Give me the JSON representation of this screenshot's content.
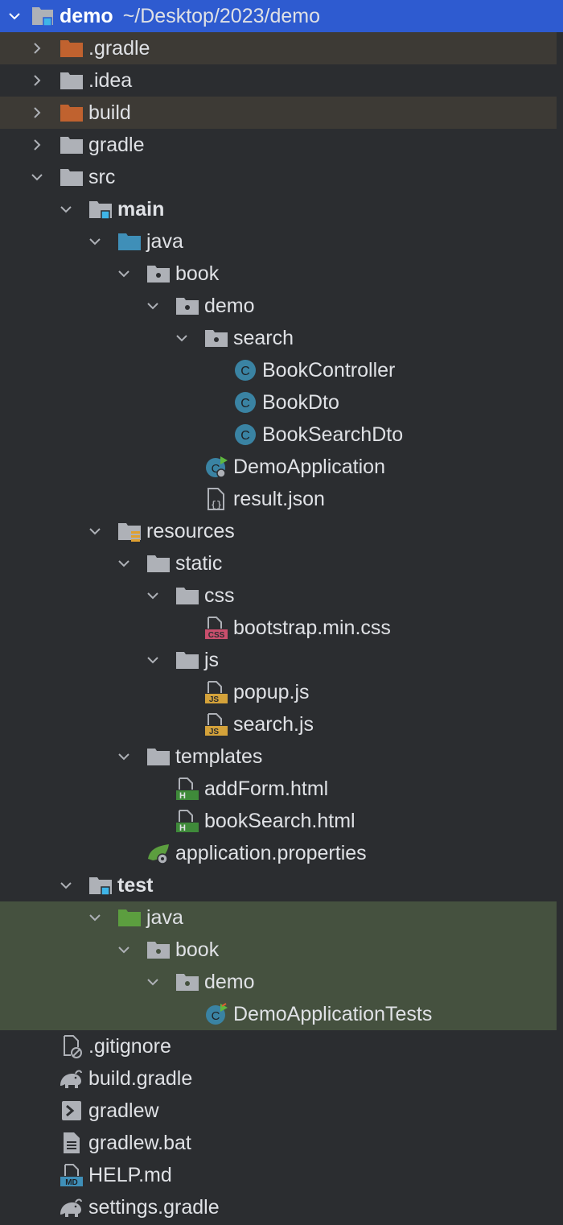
{
  "project": {
    "name": "demo",
    "path": "~/Desktop/2023/demo"
  },
  "tree": [
    {
      "label": ".gradle",
      "icon": "folder-icon"
    },
    {
      "label": ".idea",
      "icon": "folder-icon"
    },
    {
      "label": "build",
      "icon": "folder-icon"
    },
    {
      "label": "gradle",
      "icon": "folder-icon"
    },
    {
      "label": "src",
      "icon": "folder-icon"
    },
    {
      "label": "main",
      "icon": "module-folder-icon"
    },
    {
      "label": "java",
      "icon": "source-root-icon"
    },
    {
      "label": "book",
      "icon": "package-icon"
    },
    {
      "label": "demo",
      "icon": "package-icon"
    },
    {
      "label": "search",
      "icon": "package-icon"
    },
    {
      "label": "BookController",
      "icon": "class-icon"
    },
    {
      "label": "BookDto",
      "icon": "class-icon"
    },
    {
      "label": "BookSearchDto",
      "icon": "class-icon"
    },
    {
      "label": "DemoApplication",
      "icon": "spring-boot-app-icon"
    },
    {
      "label": "result.json",
      "icon": "json-file-icon"
    },
    {
      "label": "resources",
      "icon": "resources-root-icon"
    },
    {
      "label": "static",
      "icon": "folder-icon"
    },
    {
      "label": "css",
      "icon": "folder-icon"
    },
    {
      "label": "bootstrap.min.css",
      "icon": "css-file-icon"
    },
    {
      "label": "js",
      "icon": "folder-icon"
    },
    {
      "label": "popup.js",
      "icon": "js-file-icon"
    },
    {
      "label": "search.js",
      "icon": "js-file-icon"
    },
    {
      "label": "templates",
      "icon": "folder-icon"
    },
    {
      "label": "addForm.html",
      "icon": "html-file-icon"
    },
    {
      "label": "bookSearch.html",
      "icon": "html-file-icon"
    },
    {
      "label": "application.properties",
      "icon": "spring-properties-icon"
    },
    {
      "label": "test",
      "icon": "module-folder-icon"
    },
    {
      "label": "java",
      "icon": "test-root-icon"
    },
    {
      "label": "book",
      "icon": "package-icon"
    },
    {
      "label": "demo",
      "icon": "package-icon"
    },
    {
      "label": "DemoApplicationTests",
      "icon": "test-class-icon"
    },
    {
      "label": ".gitignore",
      "icon": "gitignore-file-icon"
    },
    {
      "label": "build.gradle",
      "icon": "gradle-icon"
    },
    {
      "label": "gradlew",
      "icon": "shell-script-icon"
    },
    {
      "label": "gradlew.bat",
      "icon": "text-file-icon"
    },
    {
      "label": "HELP.md",
      "icon": "markdown-file-icon"
    },
    {
      "label": "settings.gradle",
      "icon": "gradle-icon"
    }
  ],
  "colors": {
    "selection": "#2e5bd0",
    "excluded_folder": "#c0622f",
    "folder": "#aeb1b7",
    "source_root": "#3f8fb8",
    "test_root": "#5c9e3f",
    "class_circle": "#3a83a3"
  }
}
